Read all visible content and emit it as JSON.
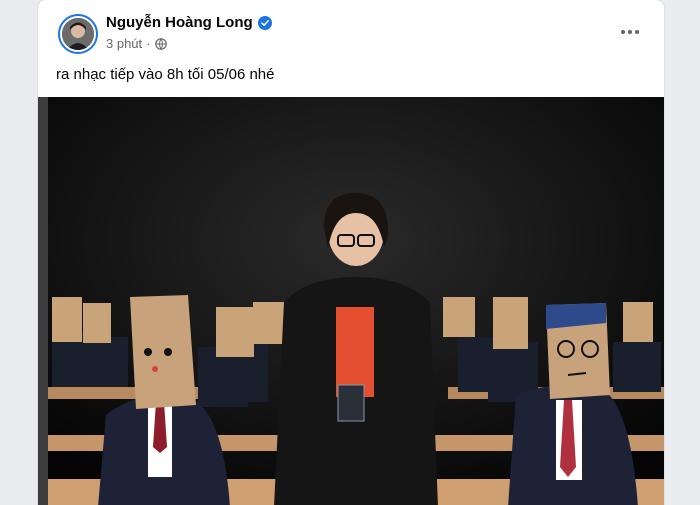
{
  "post": {
    "author": "Nguyễn Hoàng Long",
    "time": "3 phút",
    "caption": "ra nhạc tiếp vào 8h tối 05/06 nhé",
    "verified": true,
    "icons": {
      "verified": "verified-badge-icon",
      "privacy": "globe-icon",
      "more": "more-horizontal-icon"
    }
  },
  "colors": {
    "accent": "#1b74e4",
    "text_primary": "#050505",
    "text_secondary": "#65676b"
  }
}
